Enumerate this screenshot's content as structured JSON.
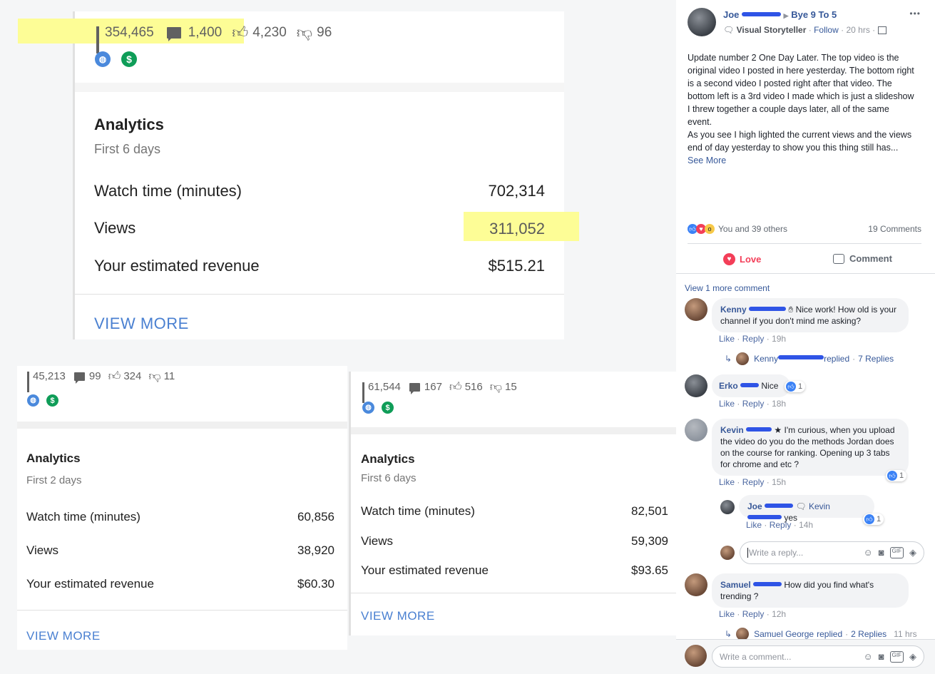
{
  "cards": {
    "main": {
      "stats": {
        "views": "354,465",
        "comments": "1,400",
        "likes": "4,230",
        "dislikes": "96"
      },
      "title": "Analytics",
      "subtitle": "First 6 days",
      "rows": [
        {
          "label": "Watch time (minutes)",
          "value": "702,314"
        },
        {
          "label": "Views",
          "value": "311,052"
        },
        {
          "label": "Your estimated revenue",
          "value": "$515.21"
        }
      ],
      "view_more": "VIEW MORE",
      "highlight_color": "#fdfd96"
    },
    "left": {
      "stats": {
        "views": "45,213",
        "comments": "99",
        "likes": "324",
        "dislikes": "11"
      },
      "title": "Analytics",
      "subtitle": "First 2 days",
      "rows": [
        {
          "label": "Watch time (minutes)",
          "value": "60,856"
        },
        {
          "label": "Views",
          "value": "38,920"
        },
        {
          "label": "Your estimated revenue",
          "value": "$60.30"
        }
      ],
      "view_more": "VIEW MORE"
    },
    "right": {
      "stats": {
        "views": "61,544",
        "comments": "167",
        "likes": "516",
        "dislikes": "15"
      },
      "title": "Analytics",
      "subtitle": "First 6 days",
      "rows": [
        {
          "label": "Watch time (minutes)",
          "value": "82,501"
        },
        {
          "label": "Views",
          "value": "59,309"
        },
        {
          "label": "Your estimated revenue",
          "value": "$93.65"
        }
      ],
      "view_more": "VIEW MORE"
    }
  },
  "post": {
    "author": "Joe",
    "group": "Bye 9 To 5",
    "badge": "Visual Storyteller",
    "follow": "Follow",
    "time": "20 hrs",
    "more": "•••",
    "text": "Update number 2 One Day Later. The top video is the original video I posted in here yesterday. The bottom right is a second video I posted right after that video. The bottom left is a 3rd video I made which is just a slideshow I threw together a couple days later, all of the same event.",
    "text2": "As you see I high lighted the current views and the views end of day yesterday to show you this thing still has...",
    "see_more": "See More",
    "reactions_text": "You and 39 others",
    "comments_count": "19 Comments",
    "love_label": "Love",
    "comment_label": "Comment",
    "accent_love": "#f33e58",
    "accent_link": "#365899"
  },
  "comments": {
    "view_more": "View 1 more comment",
    "like": "Like",
    "reply": "Reply",
    "dot": "·",
    "c1": {
      "name": "Kenny",
      "text": "Nice work! How old is your channel if you don't mind me asking?",
      "time": "19h",
      "replies_author": "Kenny",
      "replies_text": "replied",
      "replies_count": "7 Replies"
    },
    "c2": {
      "name": "Erko",
      "text": "Nice",
      "time": "18h",
      "likes": "1"
    },
    "c3": {
      "name": "Kevin",
      "text": "I'm curious, when you upload the video do you do the methods Jordan does on the course for ranking. Opening up 3 tabs for chrome and etc ?",
      "time": "15h",
      "likes": "1"
    },
    "r3": {
      "name": "Joe",
      "mention": "Kevin",
      "text": "yes",
      "time": "14h",
      "likes": "1"
    },
    "reply_placeholder": "Write a reply...",
    "c4": {
      "name": "Samuel",
      "text": "How did you find what's trending ?",
      "time": "12h",
      "replies_author": "Samuel George",
      "replies_text": "replied",
      "replies_count": "2 Replies",
      "replies_time": "11 hrs"
    },
    "comment_placeholder": "Write a comment..."
  }
}
